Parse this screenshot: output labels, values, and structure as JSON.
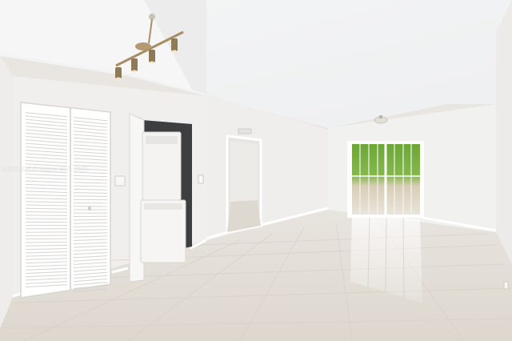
{
  "scene": {
    "description_label": "Empty apartment interior",
    "colors": {
      "ceiling": "#f2f2f3",
      "wall": "#efeeec",
      "floor_tile": "#e6e1da",
      "trim": "#ffffff",
      "window_green": "#5f9a2f",
      "fixture_brass": "#a88d63"
    }
  },
  "watermark": {
    "text": "A1181826 © Miami MLS 2025"
  }
}
